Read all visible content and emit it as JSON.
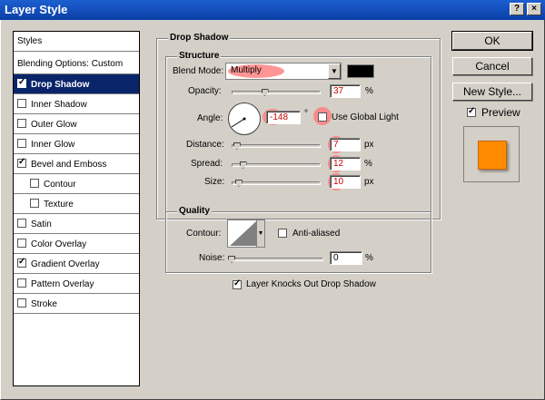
{
  "window": {
    "title": "Layer Style"
  },
  "styles_panel": {
    "header": "Styles",
    "blending": "Blending Options: Custom",
    "items": [
      {
        "label": "Drop Shadow",
        "checked": true
      },
      {
        "label": "Inner Shadow",
        "checked": false
      },
      {
        "label": "Outer Glow",
        "checked": false
      },
      {
        "label": "Inner Glow",
        "checked": false
      },
      {
        "label": "Bevel and Emboss",
        "checked": true
      },
      {
        "label": "Contour",
        "checked": false
      },
      {
        "label": "Texture",
        "checked": false
      },
      {
        "label": "Satin",
        "checked": false
      },
      {
        "label": "Color Overlay",
        "checked": false
      },
      {
        "label": "Gradient Overlay",
        "checked": true
      },
      {
        "label": "Pattern Overlay",
        "checked": false
      },
      {
        "label": "Stroke",
        "checked": false
      }
    ]
  },
  "drop_shadow": {
    "title": "Drop Shadow",
    "structure_title": "Structure",
    "blend_mode_label": "Blend Mode:",
    "blend_mode_value": "Multiply",
    "shadow_color": "#000000",
    "opacity_label": "Opacity:",
    "opacity_value": "37",
    "opacity_unit": "%",
    "angle_label": "Angle:",
    "angle_value": "-148",
    "angle_unit": "°",
    "global_light_label": "Use Global Light",
    "global_light_checked": false,
    "distance_label": "Distance:",
    "distance_value": "7",
    "distance_unit": "px",
    "spread_label": "Spread:",
    "spread_value": "12",
    "spread_unit": "%",
    "size_label": "Size:",
    "size_value": "10",
    "size_unit": "px"
  },
  "quality": {
    "title": "Quality",
    "contour_label": "Contour:",
    "anti_aliased_label": "Anti-aliased",
    "anti_aliased_checked": false,
    "noise_label": "Noise:",
    "noise_value": "0",
    "noise_unit": "%",
    "knockout_label": "Layer Knocks Out Drop Shadow",
    "knockout_checked": true
  },
  "buttons": {
    "ok": "OK",
    "cancel": "Cancel",
    "new_style": "New Style...",
    "preview_label": "Preview",
    "preview_checked": true
  },
  "colors": {
    "preview_swatch": "#ff8c00",
    "highlight": "#ff7a7a",
    "selection": "#0a246a"
  }
}
